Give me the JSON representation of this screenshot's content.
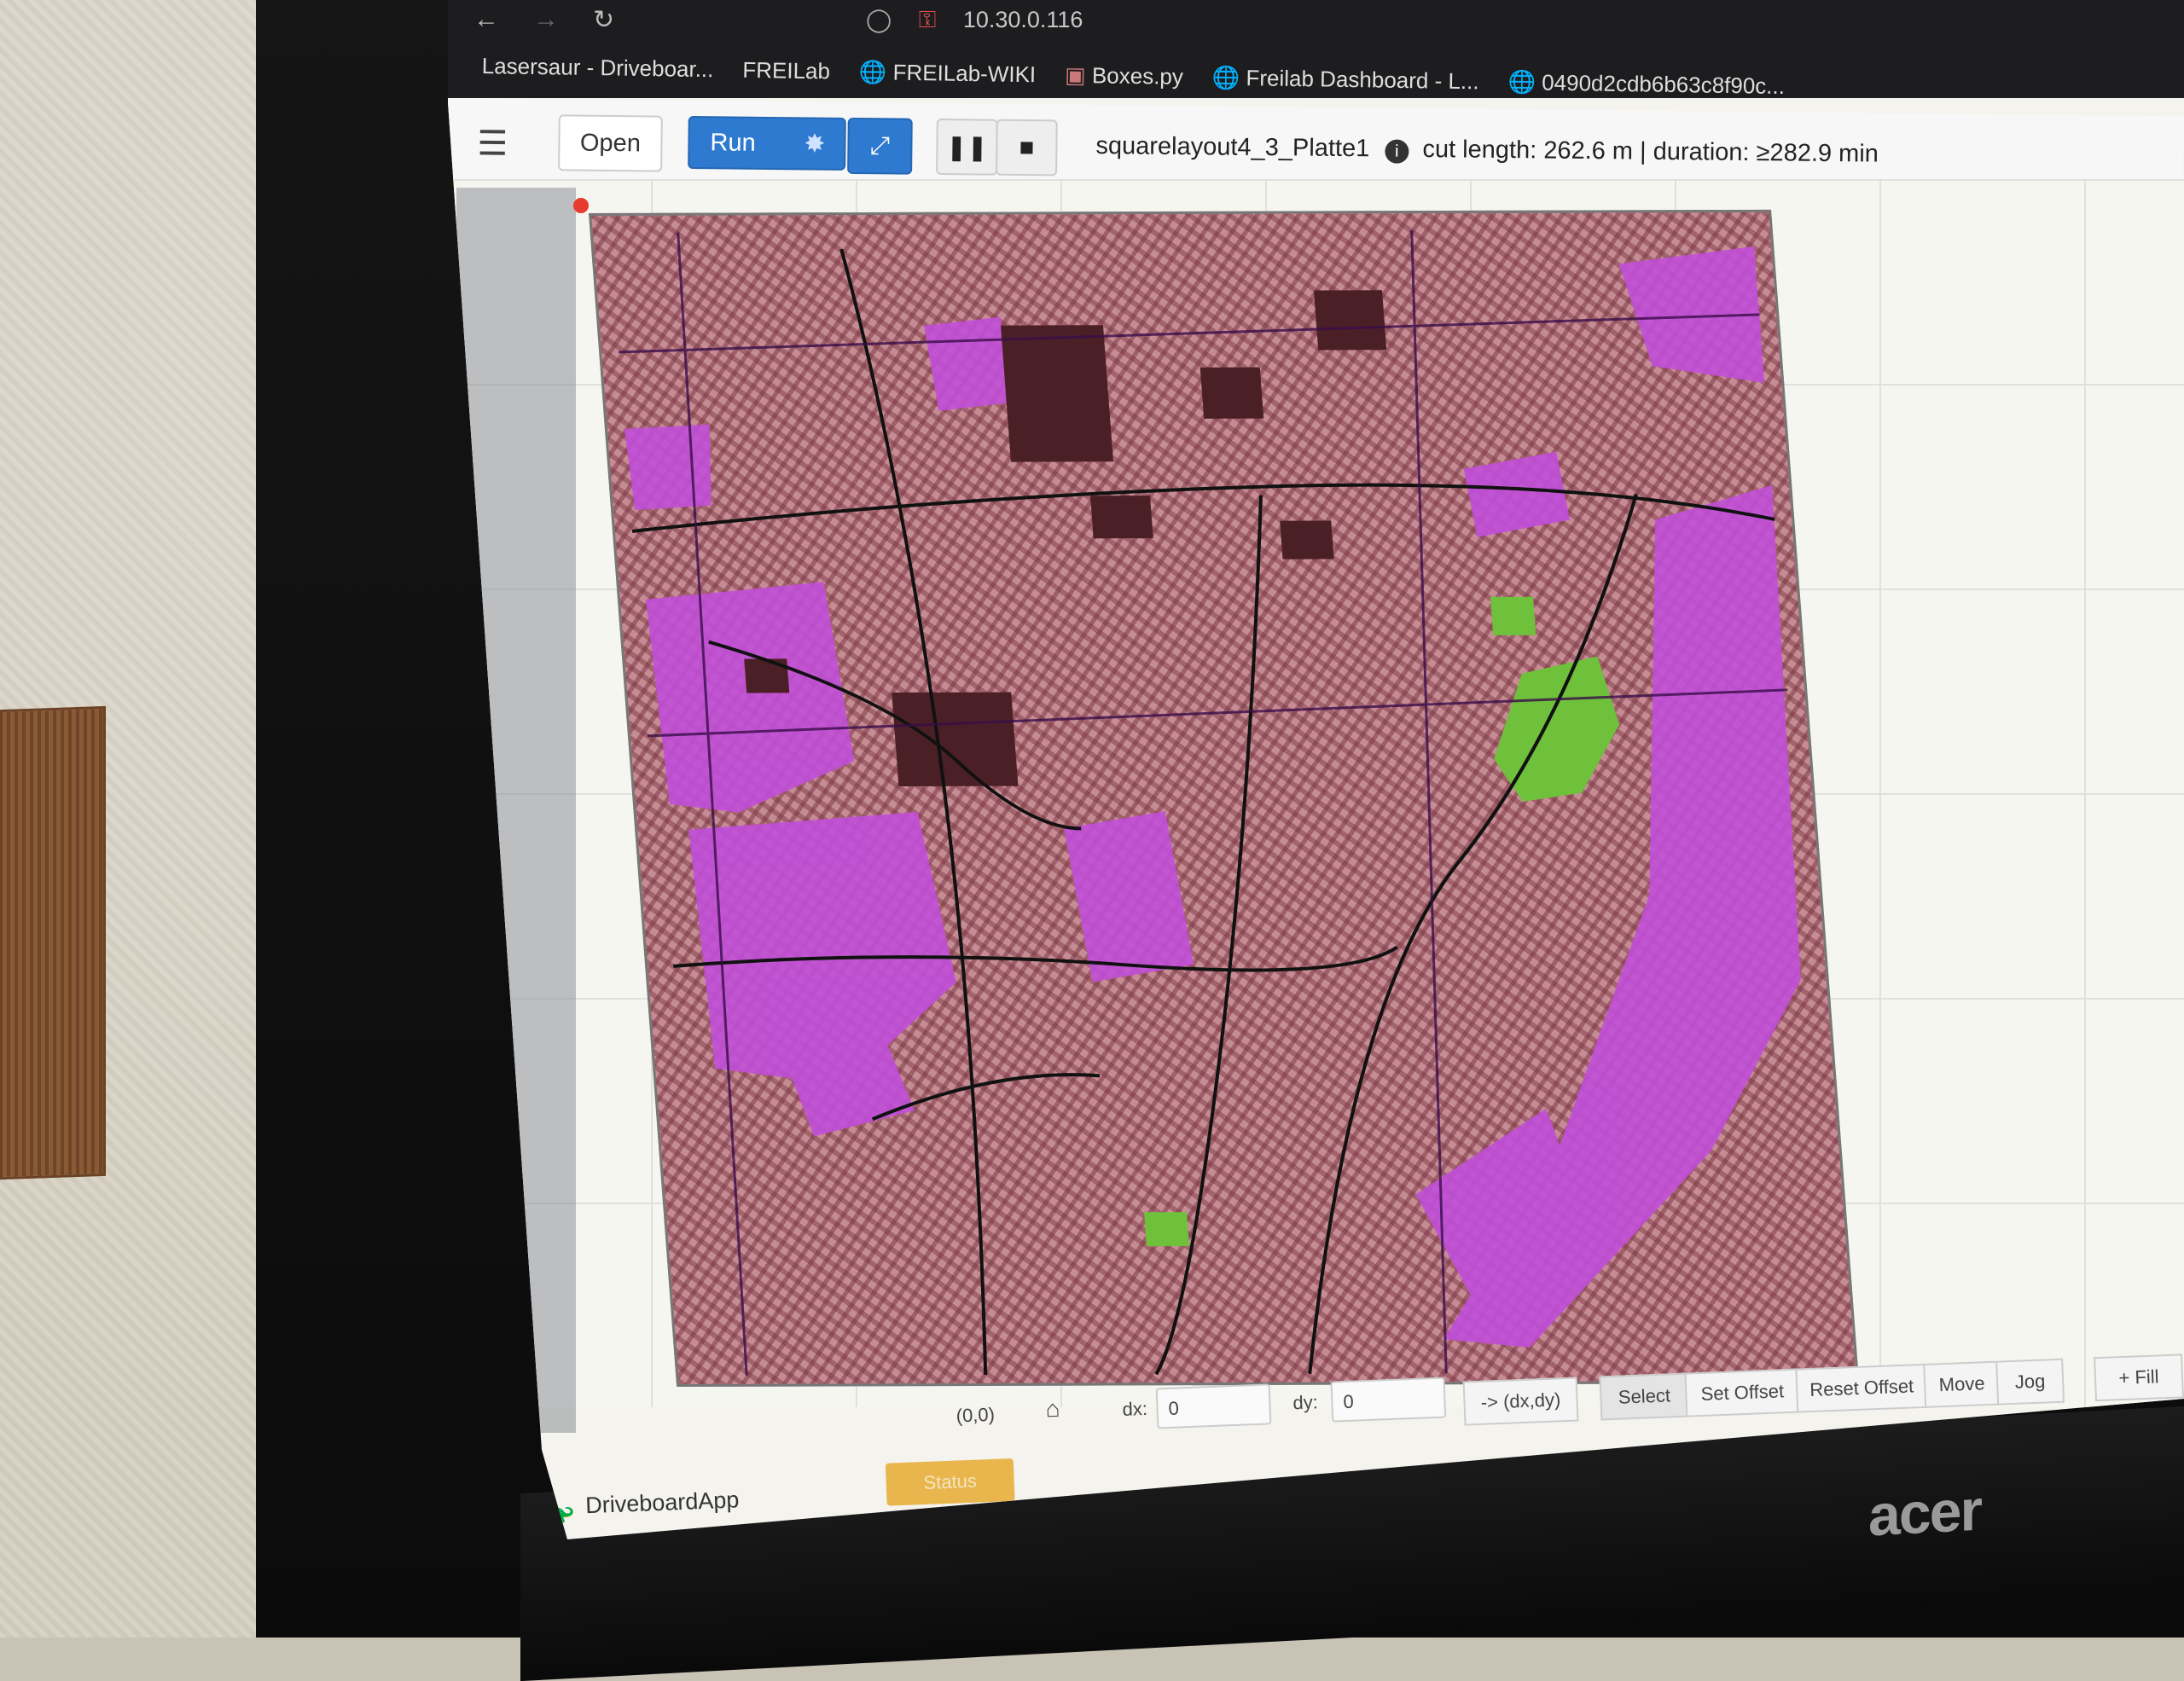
{
  "browser": {
    "url": "10.30.0.116",
    "tabs": [
      "Lasersaur - Driveboar...",
      "FREILab",
      "FREILab-WIKI",
      "Boxes.py",
      "Freilab Dashboard - L...",
      "0490d2cdb6b63c8f90c..."
    ]
  },
  "toolbar": {
    "open_label": "Open",
    "run_label": "Run",
    "job_name": "squarelayout4_3_Platte1",
    "job_stats": "cut length: 262.6 m | duration: ≥282.9 min"
  },
  "bottom": {
    "origin_label": "(0,0)",
    "dx_label": "dx:",
    "dx_value": "0",
    "dy_label": "dy:",
    "dy_value": "0",
    "apply_offset_label": "-> (dx,dy)",
    "modes": [
      "Select",
      "Set Offset",
      "Reset Offset",
      "Move",
      "Jog"
    ],
    "fill_label": "+ Fill",
    "status_label": "Status",
    "app_name": "DriveboardApp"
  },
  "monitor": {
    "brand": "acer"
  },
  "colors": {
    "accent": "#2f7ad1",
    "map_buildings": "#b9747c",
    "map_parks": "#c04bd8",
    "map_green": "#6fc13c",
    "map_roads": "#1a1a1a"
  }
}
